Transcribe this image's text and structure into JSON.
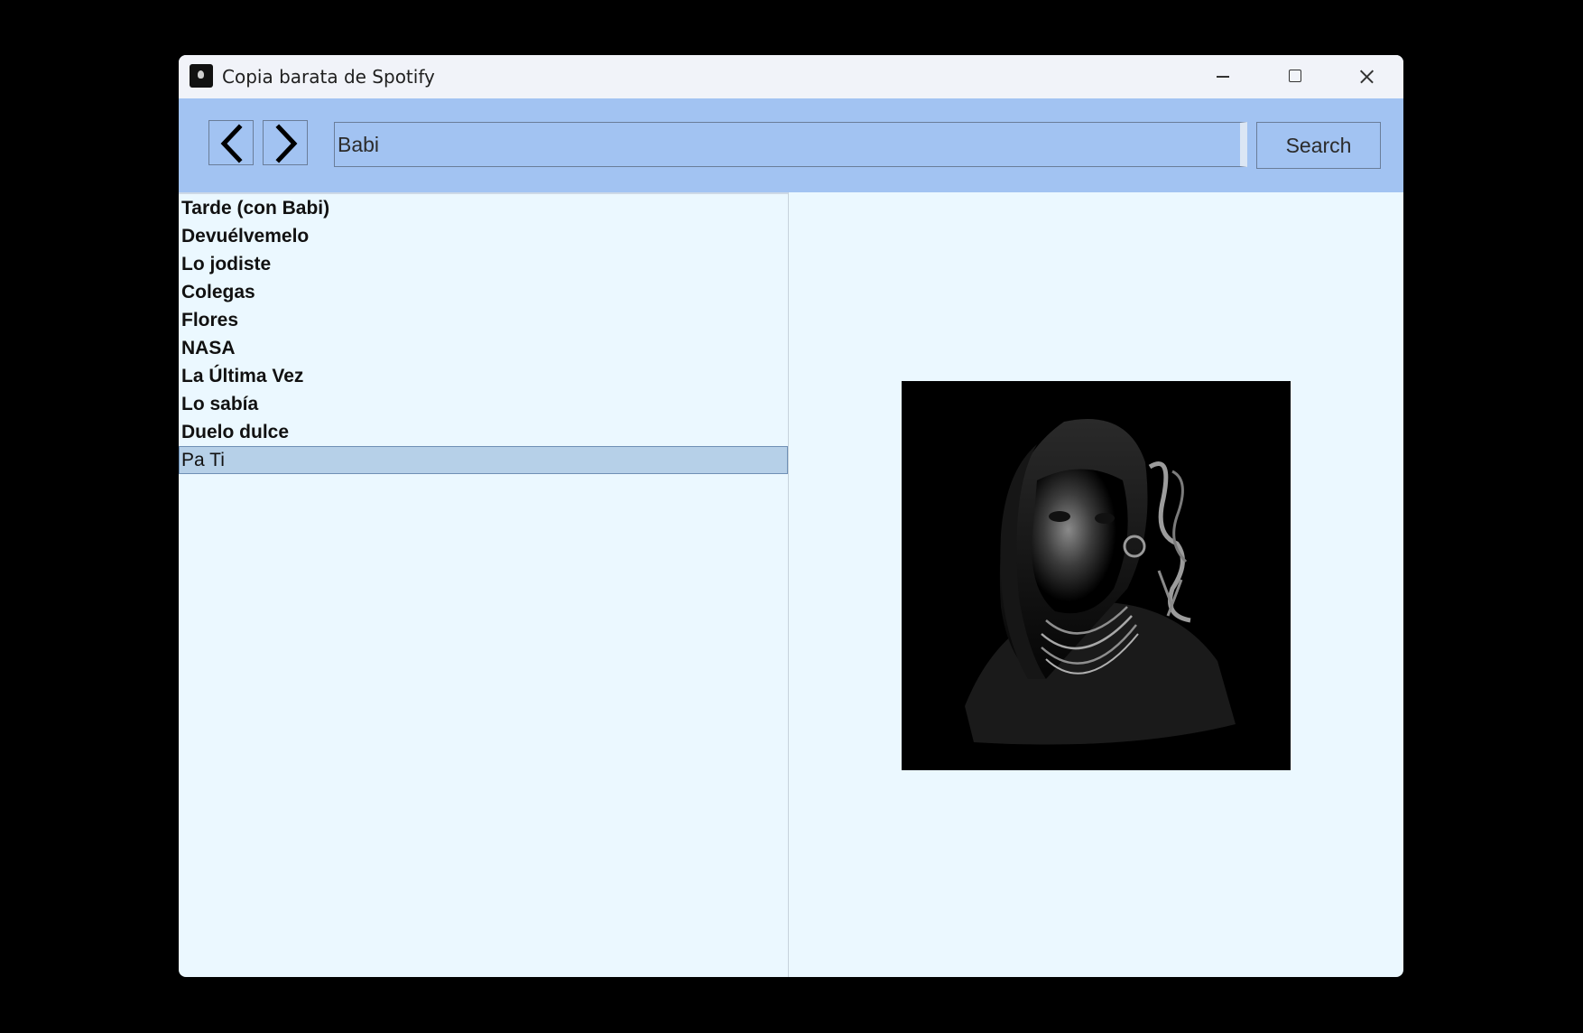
{
  "window": {
    "title": "Copia barata de Spotify"
  },
  "toolbar": {
    "back_icon": "chevron-left-icon",
    "forward_icon": "chevron-right-icon",
    "search_value": "Babi",
    "search_label": "Search"
  },
  "results": [
    {
      "label": "Tarde (con Babi)",
      "selected": false
    },
    {
      "label": "Devuélvemelo",
      "selected": false
    },
    {
      "label": "Lo jodiste",
      "selected": false
    },
    {
      "label": "Colegas",
      "selected": false
    },
    {
      "label": "Flores",
      "selected": false
    },
    {
      "label": "NASA",
      "selected": false
    },
    {
      "label": "La Última Vez",
      "selected": false
    },
    {
      "label": "Lo sabía",
      "selected": false
    },
    {
      "label": "Duelo dulce",
      "selected": false
    },
    {
      "label": "Pa Ti",
      "selected": true
    }
  ],
  "colors": {
    "toolbar_bg": "#a2c3f2",
    "content_bg": "#ebf8ff",
    "selection_bg": "#b6d0e8"
  }
}
